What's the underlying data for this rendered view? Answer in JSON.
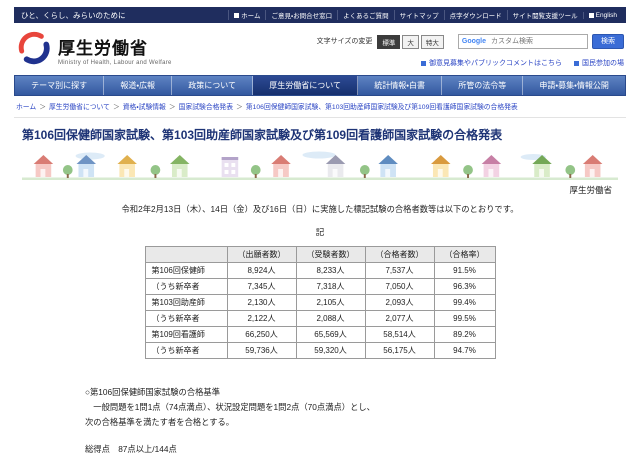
{
  "colors": {
    "topbar_bg": "#1f2d5e",
    "nav_bg": "#3d63ae",
    "nav_active_bg": "#16306e",
    "link_blue": "#2b45c4",
    "title_navy": "#1e3476",
    "search_button_bg": "#3a6cd6",
    "logo_red": "#e8453c",
    "logo_blue": "#20328f"
  },
  "top_bar": {
    "tagline": "ひと、くらし、みらいのために",
    "links": [
      {
        "label": "ホーム",
        "icon": "home-icon"
      },
      {
        "label": "ご意見・お問合せ窓口"
      },
      {
        "label": "よくあるご質問"
      },
      {
        "label": "サイトマップ"
      },
      {
        "label": "点字ダウンロード"
      },
      {
        "label": "サイト閲覧支援ツール"
      },
      {
        "label": "English",
        "icon": "globe-icon"
      }
    ]
  },
  "header": {
    "logo_title": "厚生労働省",
    "logo_subtitle": "Ministry of Health, Labour and Welfare",
    "font_size": {
      "label": "文字サイズの変更",
      "options": [
        {
          "label": "標準",
          "selected": true
        },
        {
          "label": "大",
          "selected": false
        },
        {
          "label": "特大",
          "selected": false
        }
      ]
    },
    "search": {
      "brand": "Google",
      "placeholder": "カスタム検索",
      "button_label": "検索"
    },
    "links": [
      {
        "label": "御意見募集やパブリックコメントはこちら",
        "icon": "megaphone-icon"
      },
      {
        "label": "国民参加の場",
        "icon": "participation-icon"
      }
    ]
  },
  "nav": {
    "items": [
      {
        "label": "テーマ別に探す",
        "active": false
      },
      {
        "label": "報道・広報",
        "active": false
      },
      {
        "label": "政策について",
        "active": false
      },
      {
        "label": "厚生労働省について",
        "active": true
      },
      {
        "label": "統計情報・白書",
        "active": false
      },
      {
        "label": "所管の法令等",
        "active": false
      },
      {
        "label": "申請・募集・情報公開",
        "active": false
      }
    ]
  },
  "breadcrumb": {
    "separator": "＞",
    "items": [
      "ホーム",
      "厚生労働省について",
      "資格・試験情報",
      "国家試験合格発表",
      "第106回保健師国家試験、第103回助産師国家試験及び第109回看護師国家試験の合格発表"
    ]
  },
  "page": {
    "title": "第106回保健師国家試験、第103回助産師国家試験及び第109回看護師国家試験の合格発表",
    "ministry_label": "厚生労働省",
    "intro": "令和2年2月13日（木）、14日（金）及び16日（日）に実施した標記試験の合格者数等は以下のとおりです。",
    "ki_heading": "記"
  },
  "results_table": {
    "headers": [
      "",
      "（出願者数）",
      "（受験者数）",
      "（合格者数）",
      "（合格率）"
    ],
    "rows": [
      [
        "第106回保健師",
        "8,924人",
        "8,233人",
        "7,537人",
        "91.5%"
      ],
      [
        "（うち新卒者",
        "7,345人",
        "7,318人",
        "7,050人",
        "96.3%"
      ],
      [
        "第103回助産師",
        "2,130人",
        "2,105人",
        "2,093人",
        "99.4%"
      ],
      [
        "（うち新卒者",
        "2,122人",
        "2,088人",
        "2,077人",
        "99.5%"
      ],
      [
        "第109回看護師",
        "66,250人",
        "65,569人",
        "58,514人",
        "89.2%"
      ],
      [
        "（うち新卒者",
        "59,736人",
        "59,320人",
        "56,175人",
        "94.7%"
      ]
    ]
  },
  "criteria": {
    "lines": [
      "○第106回保健師国家試験の合格基準",
      "　一般問題を1問1点（74点満点）、状況設定問題を1問2点（70点満点）とし、",
      "次の合格基準を満たす者を合格とする。"
    ],
    "total_line": "総得点　87点以上/144点"
  }
}
